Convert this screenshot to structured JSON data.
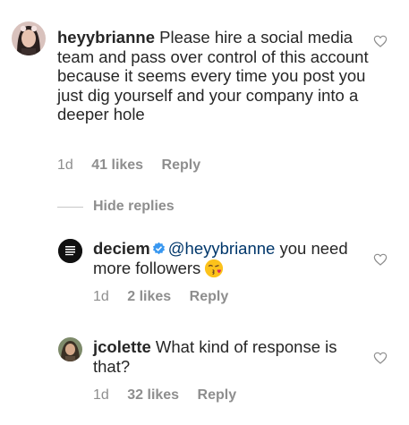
{
  "comments": [
    {
      "username": "heyybrianne",
      "text": "Please hire a social media team and pass over control of this account because it seems every time you post you just dig yourself and your company into a deeper hole",
      "time": "1d",
      "likes": "41 likes",
      "reply": "Reply"
    }
  ],
  "thread": {
    "hide_replies": "Hide replies",
    "replies": [
      {
        "username": "deciem",
        "verified": true,
        "mention": "@heyybrianne",
        "text": "you need more followers",
        "emoji": "face-blowing-a-kiss",
        "time": "1d",
        "likes": "2 likes",
        "reply": "Reply"
      },
      {
        "username": "jcolette",
        "text": "What kind of response is that?",
        "time": "1d",
        "likes": "32 likes",
        "reply": "Reply"
      }
    ]
  },
  "colors": {
    "text": "#262626",
    "meta": "#8e8e8e",
    "mention": "#00376b",
    "verified": "#3897f0",
    "divider": "#c7c7c7"
  }
}
